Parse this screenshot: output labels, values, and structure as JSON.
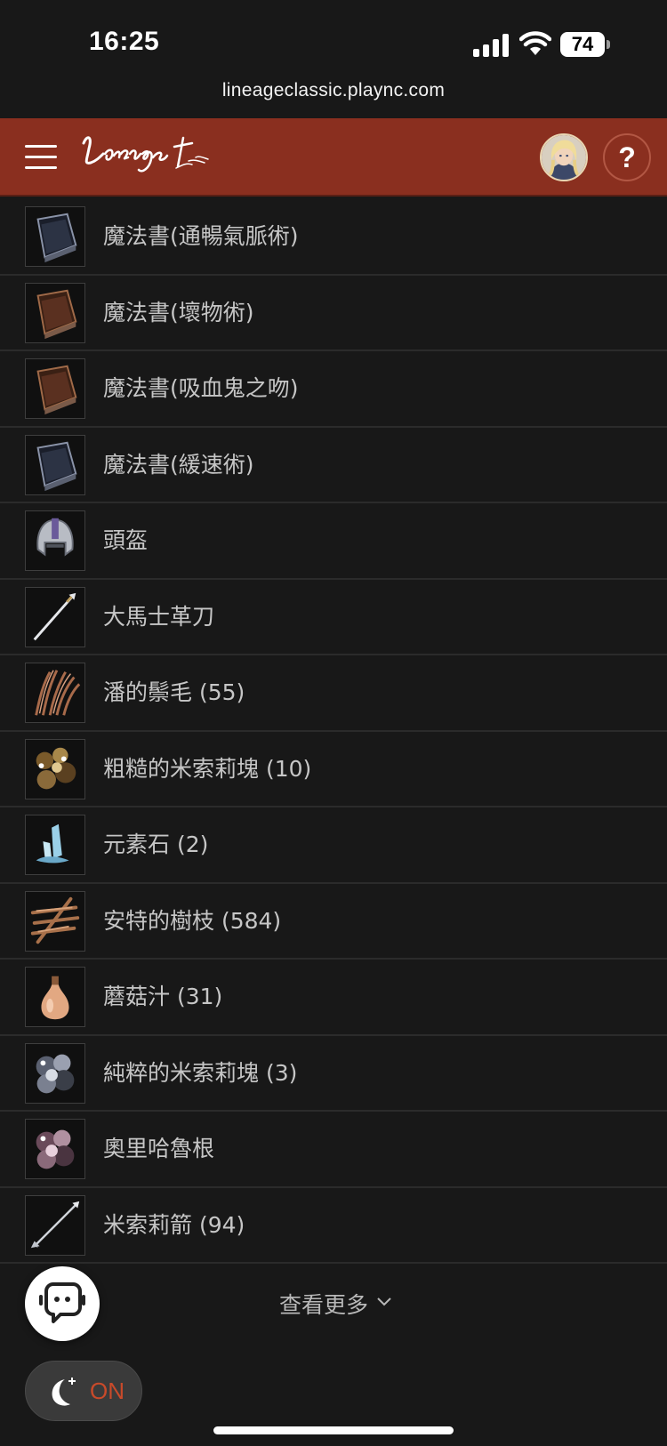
{
  "status_bar": {
    "time": "16:25",
    "battery": "74"
  },
  "browser": {
    "url": "lineageclassic.plaync.com"
  },
  "header": {
    "logo_alt": "Lineage Classic",
    "help_label": "?"
  },
  "items": [
    {
      "name": "魔法書(通暢氣脈術)",
      "icon": "dark-spellbook-icon"
    },
    {
      "name": "魔法書(壞物術)",
      "icon": "brown-spellbook-icon"
    },
    {
      "name": "魔法書(吸血鬼之吻)",
      "icon": "brown-spellbook-icon"
    },
    {
      "name": "魔法書(緩速術)",
      "icon": "dark-spellbook-icon"
    },
    {
      "name": "頭盔",
      "icon": "helmet-icon"
    },
    {
      "name": "大馬士革刀",
      "icon": "sword-icon"
    },
    {
      "name": "潘的鬃毛 (55)",
      "icon": "mane-icon"
    },
    {
      "name": "粗糙的米索莉塊 (10)",
      "icon": "ore-icon"
    },
    {
      "name": "元素石 (2)",
      "icon": "crystal-icon"
    },
    {
      "name": "安特的樹枝 (584)",
      "icon": "branches-icon"
    },
    {
      "name": "蘑菇汁 (31)",
      "icon": "gourd-icon"
    },
    {
      "name": "純粹的米索莉塊 (3)",
      "icon": "mithril-icon"
    },
    {
      "name": "奧里哈魯根",
      "icon": "oriharukon-icon"
    },
    {
      "name": "米索莉箭 (94)",
      "icon": "arrow-icon"
    }
  ],
  "load_more": {
    "label": "查看更多"
  },
  "night_mode": {
    "label": "ON"
  },
  "colors": {
    "header_bg": "#8a2f1f",
    "page_bg": "#181818",
    "accent": "#c84a2a"
  }
}
